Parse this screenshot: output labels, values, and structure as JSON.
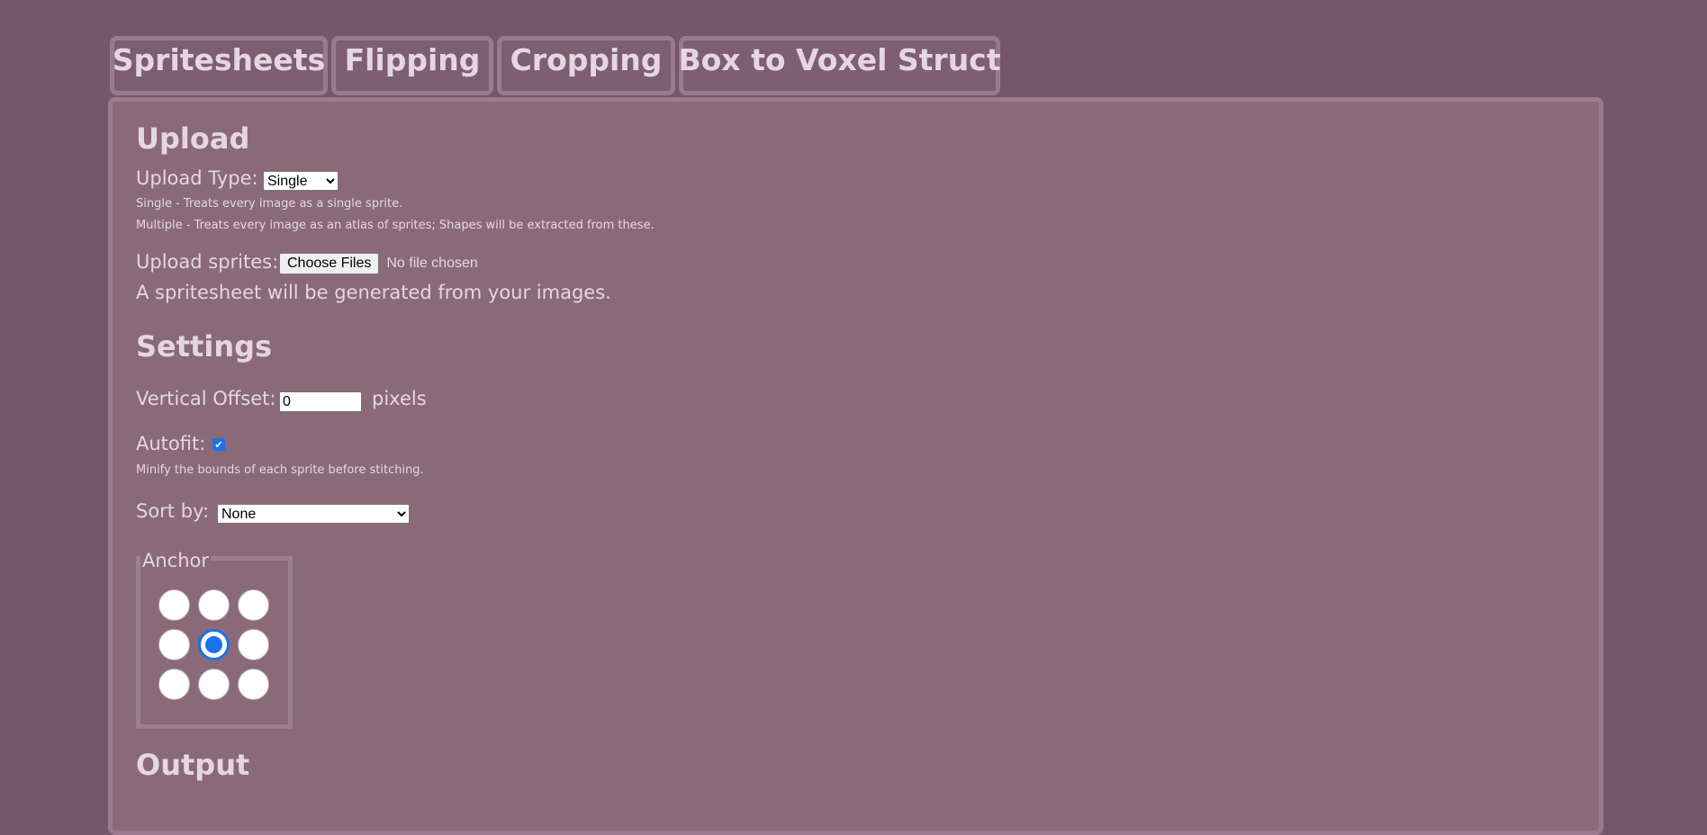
{
  "tabs": [
    {
      "label": "Spritesheets"
    },
    {
      "label": "Flipping"
    },
    {
      "label": "Cropping"
    },
    {
      "label": "Box to Voxel Struct"
    }
  ],
  "upload": {
    "heading": "Upload",
    "type_label": "Upload Type:",
    "type_value": "Single",
    "type_options": [
      "Single",
      "Multiple"
    ],
    "note_single": "Single - Treats every image as a single sprite.",
    "note_multiple": "Multiple - Treats every image as an atlas of sprites; Shapes will be extracted from these.",
    "sprites_label": "Upload sprites:",
    "file_button": "Choose Files",
    "file_status": "No file chosen",
    "info": "A spritesheet will be generated from your images."
  },
  "settings": {
    "heading": "Settings",
    "vertical_offset_label": "Vertical Offset:",
    "vertical_offset_value": "0",
    "vertical_offset_unit": "pixels",
    "autofit_label": "Autofit:",
    "autofit_checked": true,
    "autofit_note": "Minify the bounds of each sprite before stitching.",
    "sort_label": "Sort by:",
    "sort_value": "None",
    "anchor_legend": "Anchor",
    "anchor_selected": "middle-center"
  },
  "output": {
    "heading": "Output"
  }
}
